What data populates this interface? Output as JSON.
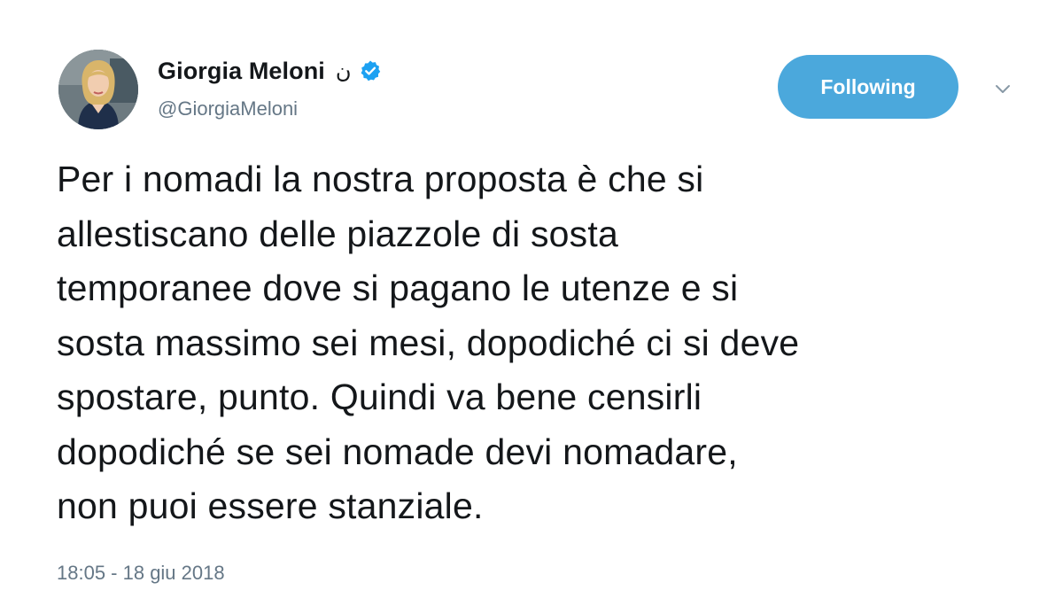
{
  "author": {
    "display_name": "Giorgia Meloni",
    "name_glyph": "ن",
    "handle": "@GiorgiaMeloni",
    "verified_icon": "verified-badge-icon",
    "avatar_icon": "profile-photo"
  },
  "actions": {
    "follow_label": "Following",
    "menu_icon": "chevron-down-icon"
  },
  "tweet": {
    "lines": [
      "Per i nomadi la nostra proposta è che si",
      "allestiscano delle piazzole di sosta",
      "temporanee dove si pagano le utenze e si",
      "sosta massimo sei mesi, dopodiché ci si deve",
      "spostare, punto. Quindi va bene censirli",
      "dopodiché se sei nomade devi nomadare,",
      "non puoi essere stanziale."
    ],
    "timestamp": "18:05 - 18 giu 2018"
  },
  "colors": {
    "button_bg": "#4ba8dc",
    "verified": "#1da1f2",
    "secondary_text": "#657786",
    "primary_text": "#14171a"
  }
}
